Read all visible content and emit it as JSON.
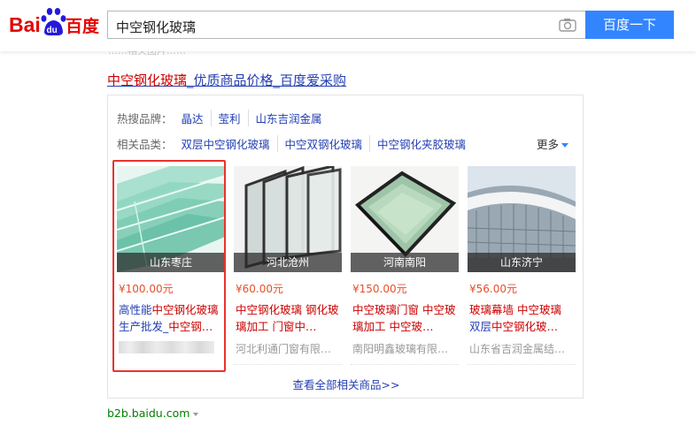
{
  "header": {
    "logo_text": [
      "Bai",
      "du",
      "百度"
    ],
    "search_value": "中空钢化玻璃",
    "search_button": "百度一下"
  },
  "top_faded_text": "……相关图片……",
  "result": {
    "title_parts": [
      "中空钢化玻璃",
      "_优质商品价格_百度爱采购"
    ]
  },
  "card": {
    "hot_brands_label": "热搜品牌：",
    "hot_brands": [
      "晶达",
      "莹利",
      "山东吉润金属"
    ],
    "categories_label": "相关品类：",
    "categories": [
      "双层中空钢化玻璃",
      "中空双钢化玻璃",
      "中空钢化夹胶玻璃"
    ],
    "more_label": "更多",
    "view_all": "查看全部相关商品>>"
  },
  "products": [
    {
      "location": "山东枣庄",
      "price": "¥100.00元",
      "name_parts": [
        [
          "高性能",
          false
        ],
        [
          "中空钢化玻璃",
          true
        ],
        [
          "生产批发_",
          false
        ],
        [
          "中空钢…",
          true
        ]
      ],
      "company": ""
    },
    {
      "location": "河北沧州",
      "price": "¥60.00元",
      "name_parts": [
        [
          "中空钢化玻璃 钢化玻璃加工 门窗中…",
          true
        ]
      ],
      "company": "河北利通门窗有限…"
    },
    {
      "location": "河南南阳",
      "price": "¥150.00元",
      "name_parts": [
        [
          "中空玻璃门窗 中空玻璃加工 中空玻…",
          true
        ]
      ],
      "company": "南阳明鑫玻璃有限…"
    },
    {
      "location": "山东济宁",
      "price": "¥56.00元",
      "name_parts": [
        [
          "玻璃幕墙 ",
          true
        ],
        [
          "中空玻璃",
          true
        ],
        [
          " 双层",
          false
        ],
        [
          "中空钢化玻…",
          true
        ]
      ],
      "company": "山东省吉润金属结…"
    }
  ],
  "footer": {
    "url": "b2b.baidu.com"
  },
  "colors": {
    "link": "#2440b3",
    "highlight": "#cc0000",
    "price": "#e6502b",
    "button": "#3385ff",
    "select_border": "#e8332f",
    "url": "#008000"
  }
}
